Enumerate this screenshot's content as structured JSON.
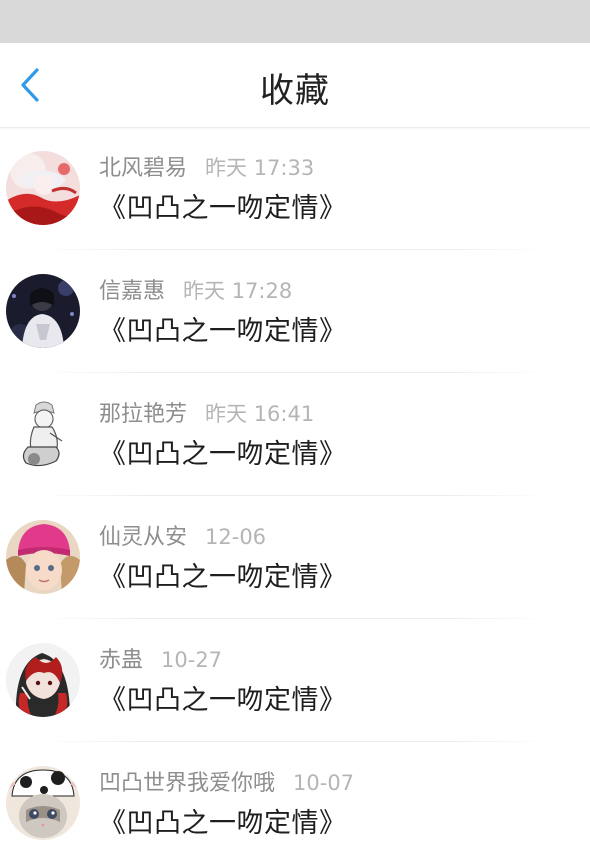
{
  "header": {
    "title": "收藏",
    "back_icon": "chevron-left-icon",
    "accent_color": "#2f9be8"
  },
  "favorites": [
    {
      "username": "北风碧易",
      "time": "昨天 17:33",
      "title": "《凹凸之一吻定情》",
      "avatar": "anime-girl-red-avatar"
    },
    {
      "username": "信嘉惠",
      "time": "昨天 17:28",
      "title": "《凹凸之一吻定情》",
      "avatar": "dark-hooded-figure-avatar"
    },
    {
      "username": "那拉艳芳",
      "time": "昨天 16:41",
      "title": "《凹凸之一吻定情》",
      "avatar": "sketch-character-avatar"
    },
    {
      "username": "仙灵从安",
      "time": "12-06",
      "title": "《凹凸之一吻定情》",
      "avatar": "girl-pink-hat-avatar"
    },
    {
      "username": "赤蛊",
      "time": "10-27",
      "title": "《凹凸之一吻定情》",
      "avatar": "red-hair-character-avatar"
    },
    {
      "username": "凹凸世界我爱你哦",
      "time": "10-07",
      "title": "《凹凸之一吻定情》",
      "avatar": "cat-cow-hat-avatar"
    }
  ]
}
